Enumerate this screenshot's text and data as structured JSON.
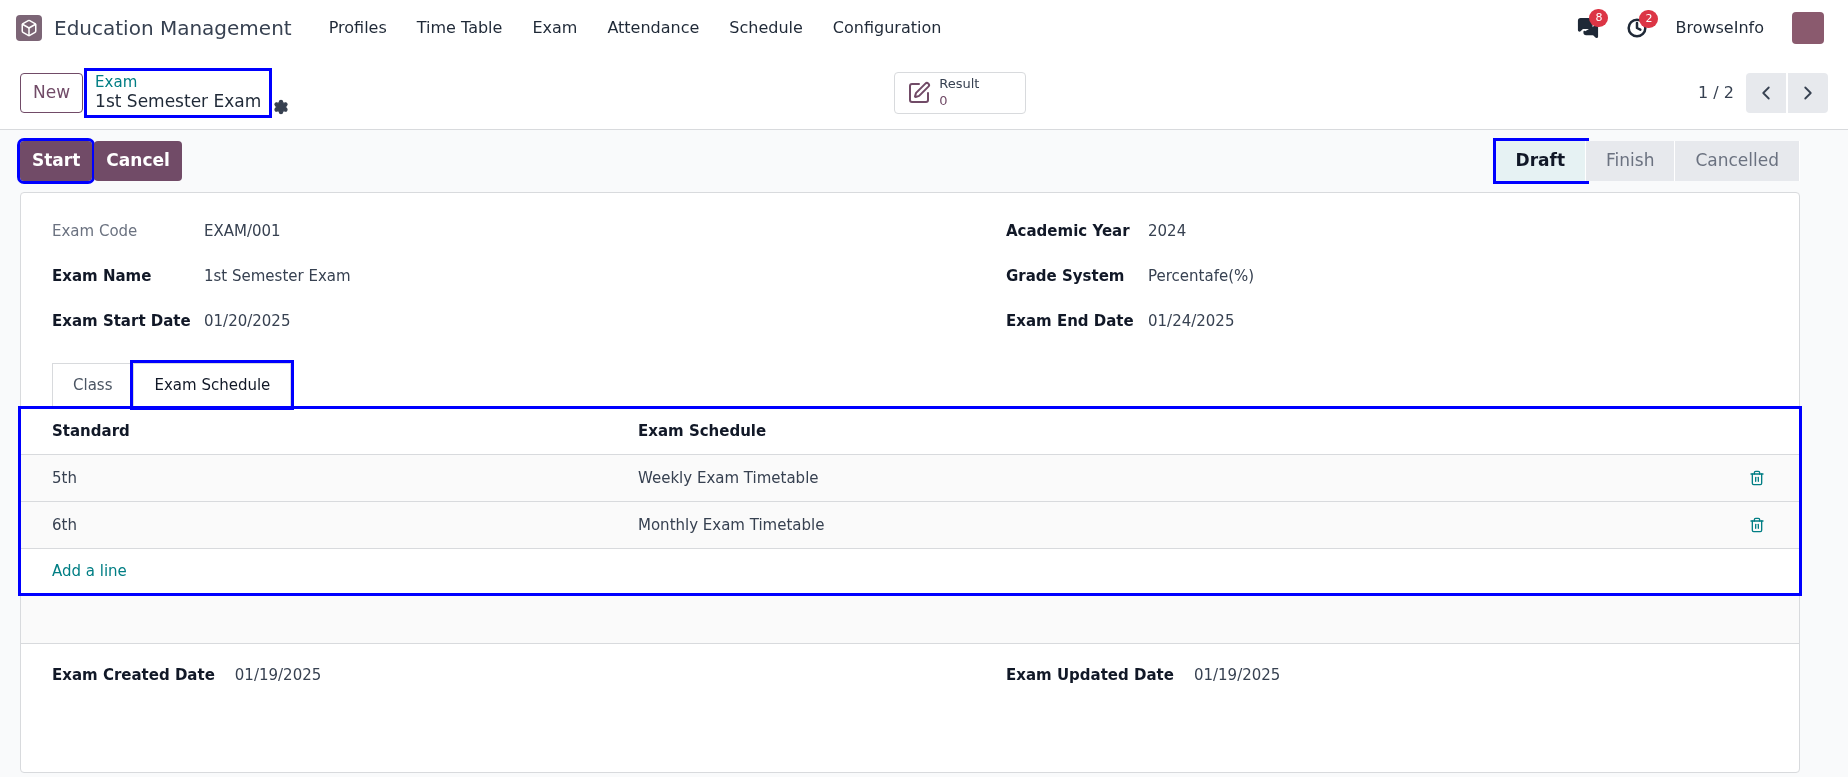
{
  "app": {
    "name": "Education Management"
  },
  "menu": [
    "Profiles",
    "Time Table",
    "Exam",
    "Attendance",
    "Schedule",
    "Configuration"
  ],
  "systray": {
    "messages_count": "8",
    "activities_count": "2",
    "user": "BrowseInfo"
  },
  "control_panel": {
    "new_button": "New",
    "breadcrumb": {
      "parent": "Exam",
      "current": "1st Semester Exam",
      "highlighted": true
    },
    "smart_button": {
      "label": "Result",
      "value": "0"
    },
    "pager": "1 / 2"
  },
  "actions": [
    {
      "label": "Start",
      "highlighted": true
    },
    {
      "label": "Cancel",
      "highlighted": false
    }
  ],
  "stages": [
    {
      "label": "Draft",
      "selected": true,
      "highlighted": true
    },
    {
      "label": "Finish",
      "selected": false,
      "highlighted": false
    },
    {
      "label": "Cancelled",
      "selected": false,
      "highlighted": false
    }
  ],
  "fields_left": [
    {
      "label": "Exam Code",
      "value": "EXAM/001",
      "bold": false
    },
    {
      "label": "Exam Name",
      "value": "1st Semester Exam",
      "bold": true
    },
    {
      "label": "Exam Start Date",
      "value": "01/20/2025",
      "bold": true
    }
  ],
  "fields_right": [
    {
      "label": "Academic Year",
      "value": "2024",
      "bold": true
    },
    {
      "label": "Grade System",
      "value": "Percentafe(%)",
      "bold": true
    },
    {
      "label": "Exam End Date",
      "value": "01/24/2025",
      "bold": true
    }
  ],
  "tabs": [
    {
      "label": "Class",
      "selected": false,
      "highlighted": false
    },
    {
      "label": "Exam Schedule",
      "selected": true,
      "highlighted": true
    }
  ],
  "table": {
    "highlighted": true,
    "columns": [
      "Standard",
      "Exam Schedule"
    ],
    "rows": [
      {
        "cells": [
          "5th",
          "Weekly Exam Timetable"
        ]
      },
      {
        "cells": [
          "6th",
          "Monthly Exam Timetable"
        ]
      }
    ],
    "add_line": "Add a line"
  },
  "footer_fields": [
    {
      "label": "Exam Created Date",
      "value": "01/19/2025"
    },
    {
      "label": "Exam Updated Date",
      "value": "01/19/2025"
    }
  ]
}
